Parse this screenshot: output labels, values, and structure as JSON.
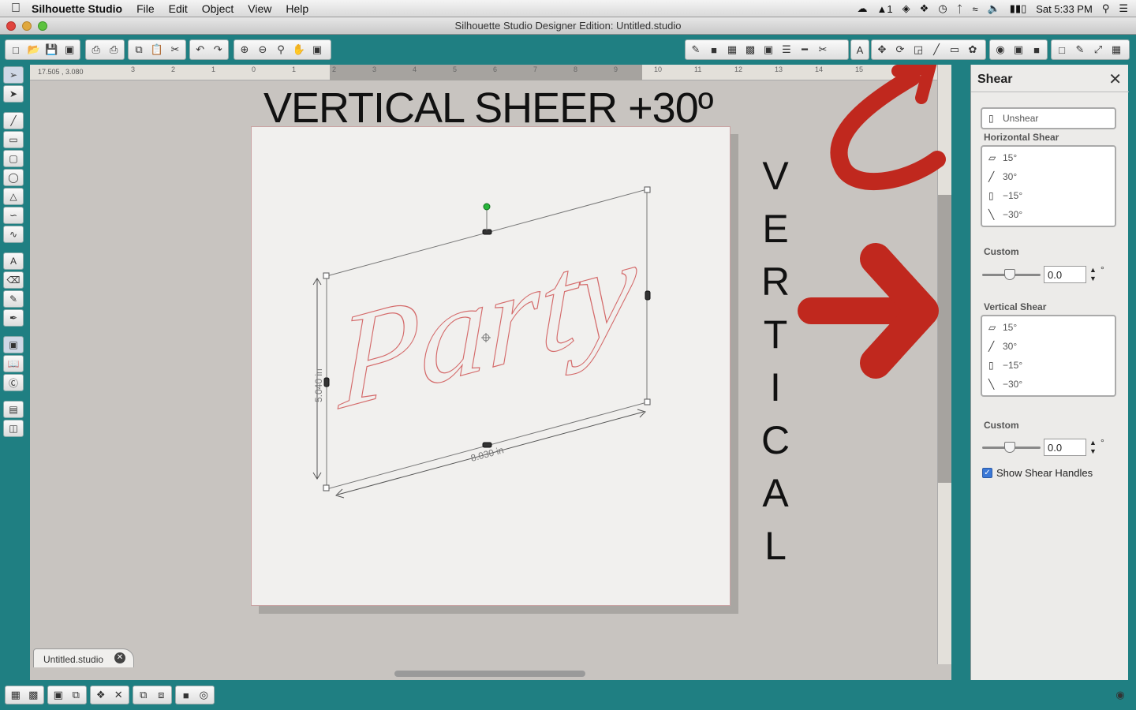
{
  "menubar": {
    "app_name": "Silhouette Studio",
    "items": [
      "File",
      "Edit",
      "Object",
      "View",
      "Help"
    ],
    "status": {
      "ai_count": "1",
      "clock": "Sat 5:33 PM"
    }
  },
  "window": {
    "title": "Silhouette Studio Designer Edition: Untitled.studio"
  },
  "ruler": {
    "coords": "17.505 , 3.080",
    "numbers": [
      "3",
      "2",
      "1",
      "0",
      "1",
      "2",
      "3",
      "4",
      "5",
      "6",
      "7",
      "8",
      "9",
      "10",
      "11",
      "12",
      "13",
      "14",
      "15"
    ]
  },
  "canvas": {
    "heading": "VERTICAL SHEER +30º",
    "side_letters": [
      "V",
      "E",
      "R",
      "T",
      "I",
      "C",
      "A",
      "L"
    ],
    "design_text": "Party",
    "width_label": "8.030 in",
    "height_label": "5.040 in"
  },
  "doc_tab": {
    "label": "Untitled.studio",
    "close": "✕"
  },
  "panel": {
    "title": "Shear",
    "unshear_label": "Unshear",
    "horizontal_label": "Horizontal Shear",
    "horizontal_options": [
      "15°",
      "30°",
      "−15°",
      "−30°"
    ],
    "custom_label": "Custom",
    "horizontal_custom_value": "0.0",
    "vertical_label": "Vertical Shear",
    "vertical_options": [
      "15°",
      "30°",
      "−15°",
      "−30°"
    ],
    "vertical_custom_value": "0.0",
    "degree_symbol": "°",
    "show_handles_label": "Show Shear Handles",
    "show_handles_checked": true
  },
  "colors": {
    "chrome_teal": "#1f7f82",
    "annotation_red": "#c0281e",
    "design_stroke": "#d46a6a",
    "handle_green": "#27b53a"
  }
}
